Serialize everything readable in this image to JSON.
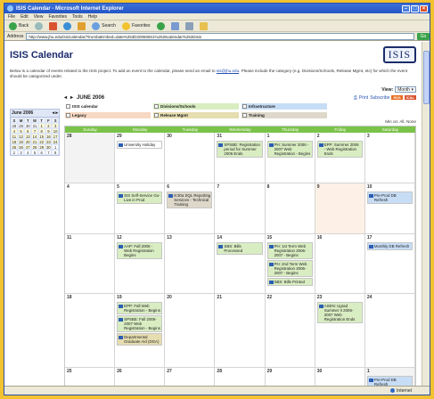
{
  "window": {
    "title": "ISIS Calendar - Microsoft Internet Explorer"
  },
  "menu": [
    "File",
    "Edit",
    "View",
    "Favorites",
    "Tools",
    "Help"
  ],
  "toolbar": {
    "back": "Back",
    "search": "Search",
    "favorites": "Favorites"
  },
  "address": {
    "label": "Address",
    "url": "http://www.jhu.edu/isis/calendar/?trumbaEmbed=date%253D20060601%2526calendar%253Disis",
    "go": "Go"
  },
  "page": {
    "title": "ISIS Calendar",
    "logo": "ISIS",
    "intro_pre": "Below is a calendar of events related to the ISIS project. To add an event to the calendar, please send an email to ",
    "intro_link": "sis@jhu.edu",
    "intro_post": ". Please include the category (e.g. Divisions/Schools, Release Mgmt, etc) for which the event should be categorized under.",
    "view_label": "View:",
    "view_value": "Month"
  },
  "mini_calendar": {
    "title": "June 2006",
    "days": [
      "S",
      "M",
      "T",
      "W",
      "T",
      "F",
      "S"
    ],
    "dates": [
      "28",
      "29",
      "30",
      "31",
      "1",
      "2",
      "3",
      "4",
      "5",
      "6",
      "7",
      "8",
      "9",
      "10",
      "11",
      "12",
      "13",
      "14",
      "15",
      "16",
      "17",
      "18",
      "19",
      "20",
      "21",
      "22",
      "23",
      "24",
      "25",
      "26",
      "27",
      "28",
      "29",
      "30",
      "1",
      "2",
      "3",
      "4",
      "5",
      "6",
      "7",
      "8"
    ]
  },
  "calendar": {
    "month_label": "JUNE 2006",
    "print": "Print",
    "subscribe": "Subscribe",
    "feeds": [
      "RSS",
      "ICAL"
    ],
    "min_label": "Min on: All, None",
    "colors": {
      "legacy": "#f6d8c3",
      "div": "#d9edc2",
      "release": "#e6ddb0",
      "training": "#ddd8c9",
      "infra": "#c7ddf5",
      "header_green": "#7bc24a"
    },
    "legend": [
      {
        "label": "ISIS calendar",
        "color": "#ffffff"
      },
      {
        "label": "Divisions/Schools",
        "color": "#d9edc2"
      },
      {
        "label": "Infrastructure",
        "color": "#c7ddf5"
      },
      {
        "label": "",
        "color": "#ffffff"
      },
      {
        "label": "Legacy",
        "color": "#f6d8c3"
      },
      {
        "label": "Release Mgmt",
        "color": "#e6ddb0"
      },
      {
        "label": "Training",
        "color": "#ddd8c9"
      }
    ],
    "weekdays": [
      "Sunday",
      "Monday",
      "Tuesday",
      "Wednesday",
      "Thursday",
      "Friday",
      "Saturday"
    ],
    "weeks": [
      {
        "days": [
          {
            "num": "28",
            "events": []
          },
          {
            "num": "29",
            "events": [
              {
                "text": "University Holiday",
                "cat": "iscal"
              }
            ]
          },
          {
            "num": "30",
            "events": []
          },
          {
            "num": "31",
            "events": [
              {
                "text": "SPSBE: Registration period for Summer 2006 Ends",
                "cat": "div"
              }
            ]
          },
          {
            "num": "1",
            "events": [
              {
                "text": "PH: Summer 2006 - 2007 Web Registration - Begins",
                "cat": "div"
              }
            ]
          },
          {
            "num": "2",
            "events": [
              {
                "text": "EPP: Summer 2006 - Web Registration Ends",
                "cat": "div"
              }
            ]
          },
          {
            "num": "3",
            "events": []
          }
        ]
      },
      {
        "days": [
          {
            "num": "4",
            "events": []
          },
          {
            "num": "5",
            "events": [
              {
                "text": "SIS Self-Service Go-Live in Prod",
                "cat": "div"
              }
            ]
          },
          {
            "num": "6",
            "events": [
              {
                "text": "8:30a SQL Reporting Services - Technical Training",
                "cat": "training"
              }
            ]
          },
          {
            "num": "7",
            "events": []
          },
          {
            "num": "8",
            "events": []
          },
          {
            "num": "9",
            "events": []
          },
          {
            "num": "10",
            "events": [
              {
                "text": "Pre-Prod DB Refresh",
                "cat": "infra"
              }
            ]
          }
        ]
      },
      {
        "days": [
          {
            "num": "11",
            "events": []
          },
          {
            "num": "12",
            "events": [
              {
                "text": "AAP: Fall 2006 - Web Registration Begins",
                "cat": "div"
              }
            ]
          },
          {
            "num": "13",
            "events": []
          },
          {
            "num": "14",
            "events": [
              {
                "text": "SBS: Bills Processed",
                "cat": "div"
              }
            ]
          },
          {
            "num": "15",
            "events": [
              {
                "text": "PH: 1st Term Web Registration 2006-2007 - Begins",
                "cat": "div"
              },
              {
                "text": "PH: 2nd Term Web Registration 2006-2007 - Begins",
                "cat": "div"
              },
              {
                "text": "SBS: Bills Printed",
                "cat": "div"
              }
            ]
          },
          {
            "num": "16",
            "events": []
          },
          {
            "num": "17",
            "events": [
              {
                "text": "Monthly DB Refresh",
                "cat": "infra"
              }
            ]
          }
        ]
      },
      {
        "days": [
          {
            "num": "18",
            "events": []
          },
          {
            "num": "19",
            "events": [
              {
                "text": "EPP: Fall Web Registration - Begins",
                "cat": "div"
              },
              {
                "text": "SPSBE: Fall 2006-2007 Web Registration - Begins",
                "cat": "div"
              },
              {
                "text": "Departmental Graduate Aid (DGA)",
                "cat": "release"
              }
            ]
          },
          {
            "num": "20",
            "events": []
          },
          {
            "num": "21",
            "events": []
          },
          {
            "num": "22",
            "events": []
          },
          {
            "num": "23",
            "events": [
              {
                "text": "ASEN: Ugrad Summer II 2006-2007 Web Registration Ends",
                "cat": "div"
              }
            ]
          },
          {
            "num": "24",
            "events": []
          }
        ]
      },
      {
        "days": [
          {
            "num": "25",
            "events": []
          },
          {
            "num": "26",
            "events": []
          },
          {
            "num": "27",
            "events": []
          },
          {
            "num": "28",
            "events": []
          },
          {
            "num": "29",
            "events": []
          },
          {
            "num": "30",
            "events": []
          },
          {
            "num": "1",
            "events": [
              {
                "text": "Pre-Prod DB Refresh",
                "cat": "infra"
              }
            ]
          }
        ]
      }
    ]
  },
  "status": {
    "left": "",
    "zone": "Internet"
  }
}
